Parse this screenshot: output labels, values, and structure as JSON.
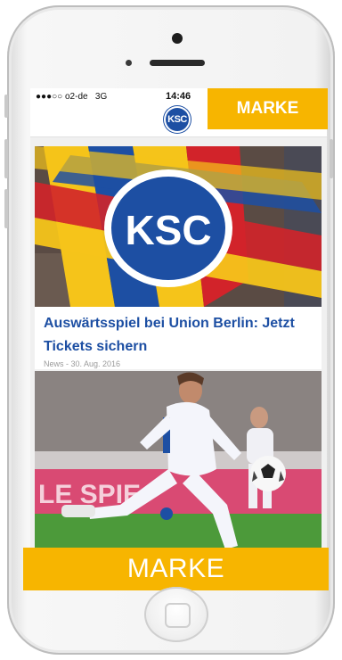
{
  "status_bar": {
    "signal": "●●●○○",
    "carrier": "o2-de",
    "network": "3G",
    "time": "14:46"
  },
  "header": {
    "logo_text": "KSC",
    "logo_color": "#1d4fa3"
  },
  "ads": {
    "top_label": "MARKE",
    "bottom_label": "MARKE",
    "color": "#f7b500"
  },
  "feed": {
    "articles": [
      {
        "title": "Auswärtsspiel bei Union Berlin: Jetzt Tickets sichern",
        "meta": "News - 30. Aug. 2016",
        "image_label": "KSC"
      },
      {
        "banner_text": "LE SPIE"
      }
    ]
  },
  "colors": {
    "title": "#1d4fa3",
    "flag_yellow": "#f5c41a",
    "flag_red": "#d2232a",
    "flag_blue": "#1d4fa3"
  }
}
